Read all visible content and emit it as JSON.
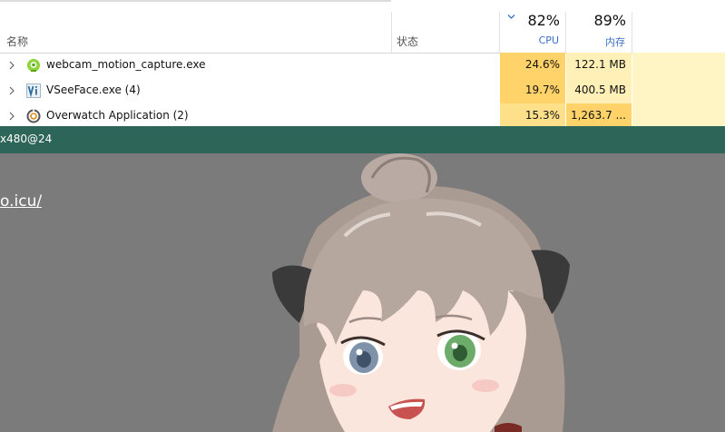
{
  "task_manager": {
    "columns": {
      "name": "名称",
      "status": "状态",
      "cpu_percent": "82%",
      "cpu_label": "CPU",
      "memory_percent": "89%",
      "memory_label": "内存"
    },
    "rows": [
      {
        "name": "webcam_motion_capture.exe",
        "icon": "webcam-motion-capture-icon",
        "cpu": "24.6%",
        "memory": "122.1 MB",
        "cpu_color": "#ffd36a",
        "mem_color": "#fff0b8"
      },
      {
        "name": "VSeeFace.exe (4)",
        "icon": "vseeface-icon",
        "cpu": "19.7%",
        "memory": "400.5 MB",
        "cpu_color": "#ffd36a",
        "mem_color": "#fff0b8"
      },
      {
        "name": "Overwatch Application (2)",
        "icon": "overwatch-icon",
        "cpu": "15.3%",
        "memory": "1,263.7 ...",
        "cpu_color": "#ffe08a",
        "mem_color": "#ffd36a"
      }
    ]
  },
  "green_bar": {
    "text": "x480@24"
  },
  "viewer": {
    "url_text": "o.icu/"
  },
  "colors": {
    "green_bar": "#2d6658",
    "viewer_bg": "#7b7b7b",
    "accent_blue": "#3a6fc3"
  }
}
